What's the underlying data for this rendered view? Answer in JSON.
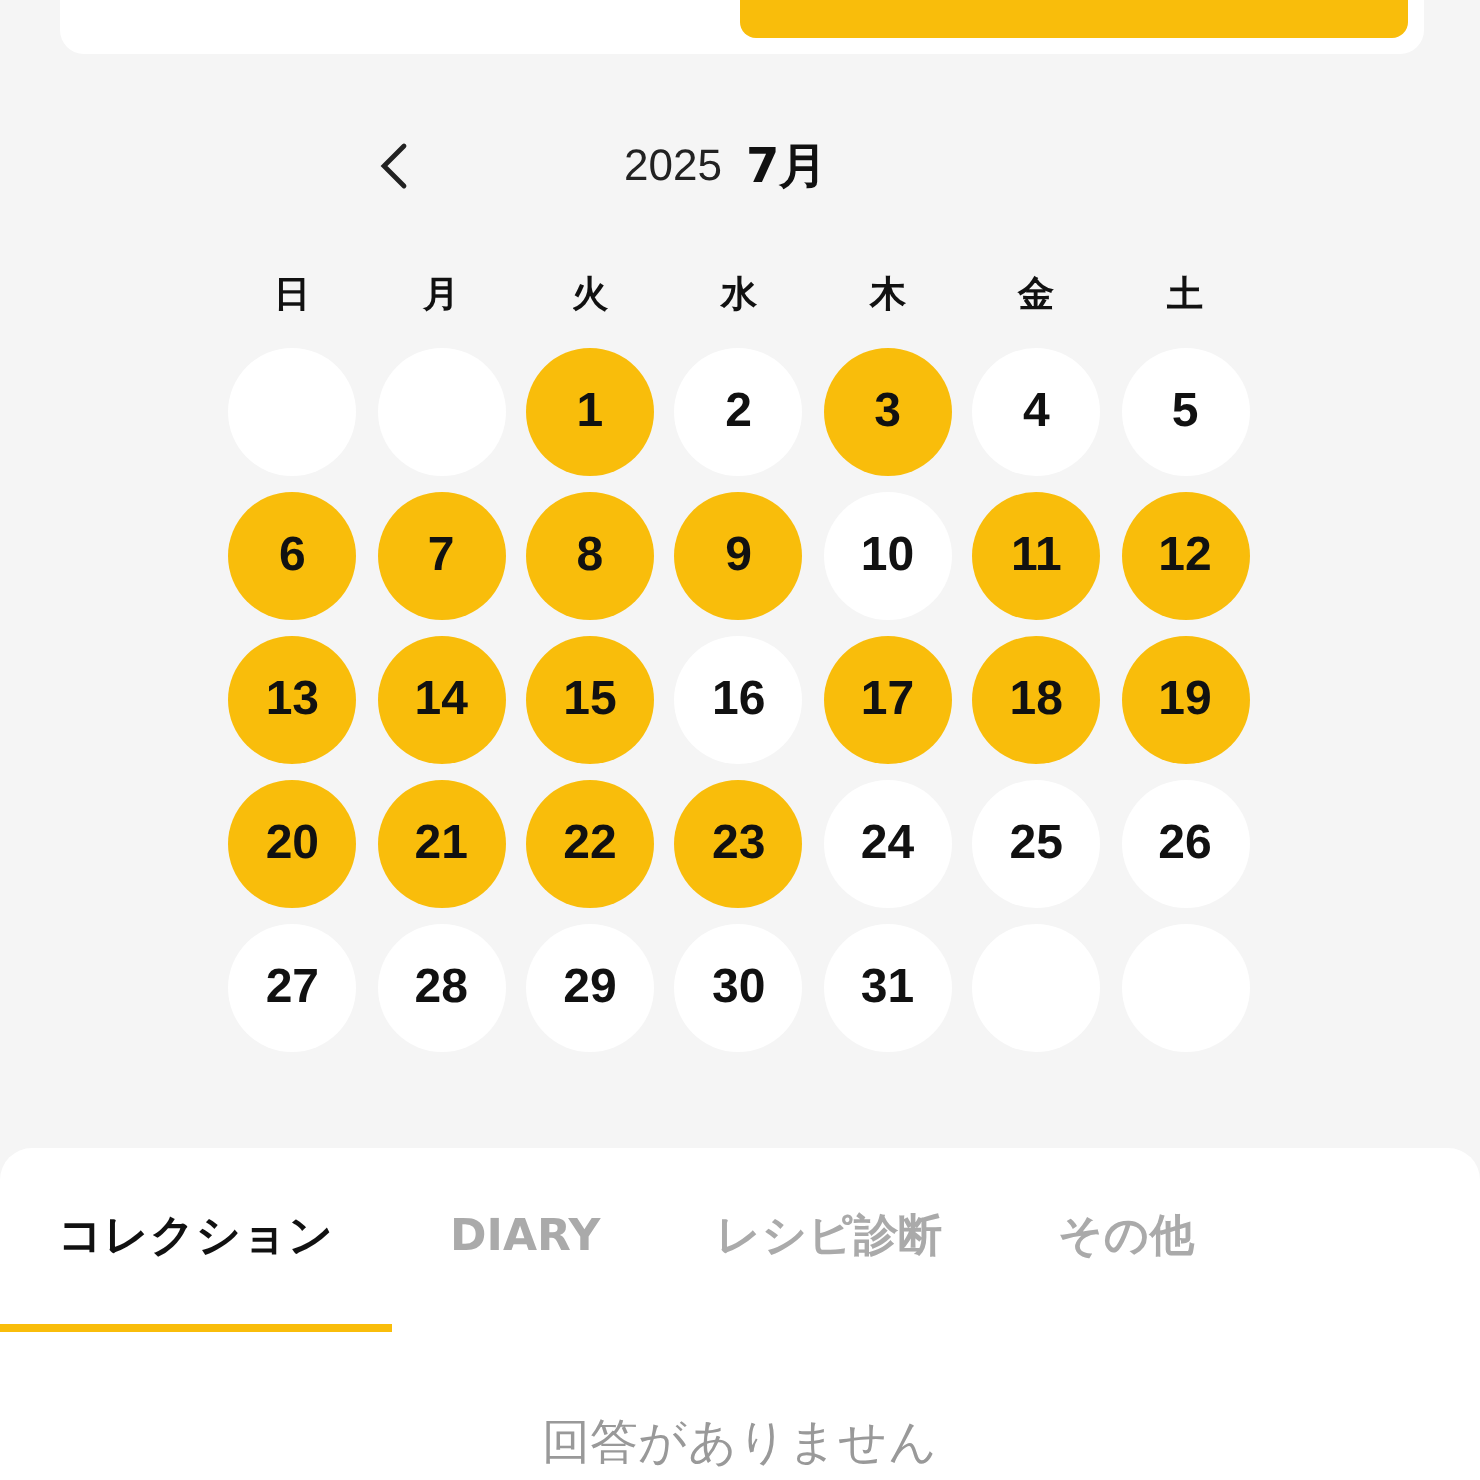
{
  "calendar": {
    "year": "2025",
    "month": "7月",
    "weekdays": [
      "日",
      "月",
      "火",
      "水",
      "木",
      "金",
      "土"
    ],
    "cells": [
      {
        "kind": "blank"
      },
      {
        "kind": "blank"
      },
      {
        "kind": "day",
        "day": "1",
        "marked": true
      },
      {
        "kind": "day",
        "day": "2",
        "marked": false
      },
      {
        "kind": "day",
        "day": "3",
        "marked": true
      },
      {
        "kind": "day",
        "day": "4",
        "marked": false
      },
      {
        "kind": "day",
        "day": "5",
        "marked": false
      },
      {
        "kind": "day",
        "day": "6",
        "marked": true
      },
      {
        "kind": "day",
        "day": "7",
        "marked": true
      },
      {
        "kind": "day",
        "day": "8",
        "marked": true
      },
      {
        "kind": "day",
        "day": "9",
        "marked": true
      },
      {
        "kind": "day",
        "day": "10",
        "marked": false
      },
      {
        "kind": "day",
        "day": "11",
        "marked": true
      },
      {
        "kind": "day",
        "day": "12",
        "marked": true
      },
      {
        "kind": "day",
        "day": "13",
        "marked": true
      },
      {
        "kind": "day",
        "day": "14",
        "marked": true
      },
      {
        "kind": "day",
        "day": "15",
        "marked": true
      },
      {
        "kind": "day",
        "day": "16",
        "marked": false
      },
      {
        "kind": "day",
        "day": "17",
        "marked": true
      },
      {
        "kind": "day",
        "day": "18",
        "marked": true
      },
      {
        "kind": "day",
        "day": "19",
        "marked": true
      },
      {
        "kind": "day",
        "day": "20",
        "marked": true
      },
      {
        "kind": "day",
        "day": "21",
        "marked": true
      },
      {
        "kind": "day",
        "day": "22",
        "marked": true
      },
      {
        "kind": "day",
        "day": "23",
        "marked": true
      },
      {
        "kind": "day",
        "day": "24",
        "marked": false
      },
      {
        "kind": "day",
        "day": "25",
        "marked": false
      },
      {
        "kind": "day",
        "day": "26",
        "marked": false
      },
      {
        "kind": "day",
        "day": "27",
        "marked": false
      },
      {
        "kind": "day",
        "day": "28",
        "marked": false
      },
      {
        "kind": "day",
        "day": "29",
        "marked": false
      },
      {
        "kind": "day",
        "day": "30",
        "marked": false
      },
      {
        "kind": "day",
        "day": "31",
        "marked": false
      },
      {
        "kind": "blank"
      },
      {
        "kind": "blank"
      }
    ]
  },
  "tabs": [
    {
      "label": "コレクション",
      "selected": true
    },
    {
      "label": "DIARY",
      "selected": false
    },
    {
      "label": "レシピ診断",
      "selected": false
    },
    {
      "label": "その他",
      "selected": false
    }
  ],
  "empty_message": "回答がありません"
}
